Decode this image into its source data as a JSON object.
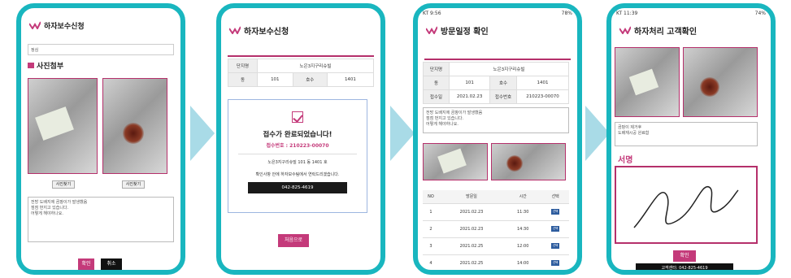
{
  "phone1": {
    "title": "하자보수신청",
    "field_value": "정심",
    "section_title": "사진첨부",
    "photo_btn1": "사진찾기",
    "photo_btn2": "사진찾기",
    "description_lines": [
      "전방 도배지에 곰팡이가 발생했음",
      "점점 번지고 있습니다.",
      "어떻게 해야하나요."
    ],
    "confirm_label": "확인",
    "cancel_label": "취소"
  },
  "phone2": {
    "title": "하자보수신청",
    "complex_label": "단지명",
    "complex_value": "노은3지구리슈빌",
    "dong_label": "동",
    "dong_value": "101",
    "ho_label": "호수",
    "ho_value": "1401",
    "done_title": "접수가 완료되었습니다!",
    "receipt": "접수번호 : 210223-00070",
    "address": "노은3지구리슈빌 101 동 1401 호",
    "notice": "확인사항 안에 하자보수팀에서 연락드리겠습니다.",
    "phone_number": "042-825-4619",
    "home_btn": "처음으로"
  },
  "phone3": {
    "status_left": "KT 9:56",
    "status_right": "78%",
    "title": "방문일정 확인",
    "complex_label": "단지명",
    "complex_value": "노은3지구리슈빌",
    "dong_label": "동",
    "dong_value": "101",
    "ho_label": "호수",
    "ho_value": "1401",
    "date_label": "접수일",
    "date_value": "2021.02.23",
    "receipt_label": "접수번호",
    "receipt_value": "210223-00070",
    "description_lines": [
      "전방 도배지에 곰팡이가 발생했음",
      "점점 번지고 있습니다.",
      "어떻게 해야하나요."
    ],
    "schedule_headers": [
      "NO",
      "방문일",
      "시간",
      "선택"
    ],
    "schedule_rows": [
      {
        "no": "1",
        "date": "2021.02.23",
        "time": "11:30",
        "select": "선택"
      },
      {
        "no": "2",
        "date": "2021.02.23",
        "time": "14:30",
        "select": "선택"
      },
      {
        "no": "3",
        "date": "2021.02.25",
        "time": "12:00",
        "select": "선택"
      },
      {
        "no": "4",
        "date": "2021.02.25",
        "time": "14:00",
        "select": "선택"
      }
    ]
  },
  "phone4": {
    "status_left": "KT 11:39",
    "status_right": "74%",
    "title": "하자처리 고객확인",
    "result_lines": [
      "곰팡이 제거후",
      "도배재시공 완료함"
    ],
    "sign_title": "서명",
    "confirm_label": "확인",
    "center": "고객센터: 042-825-4619"
  },
  "colors": {
    "frame": "#19b6bf",
    "accent": "#c43a7a",
    "arrow": "#a9dbe7"
  }
}
